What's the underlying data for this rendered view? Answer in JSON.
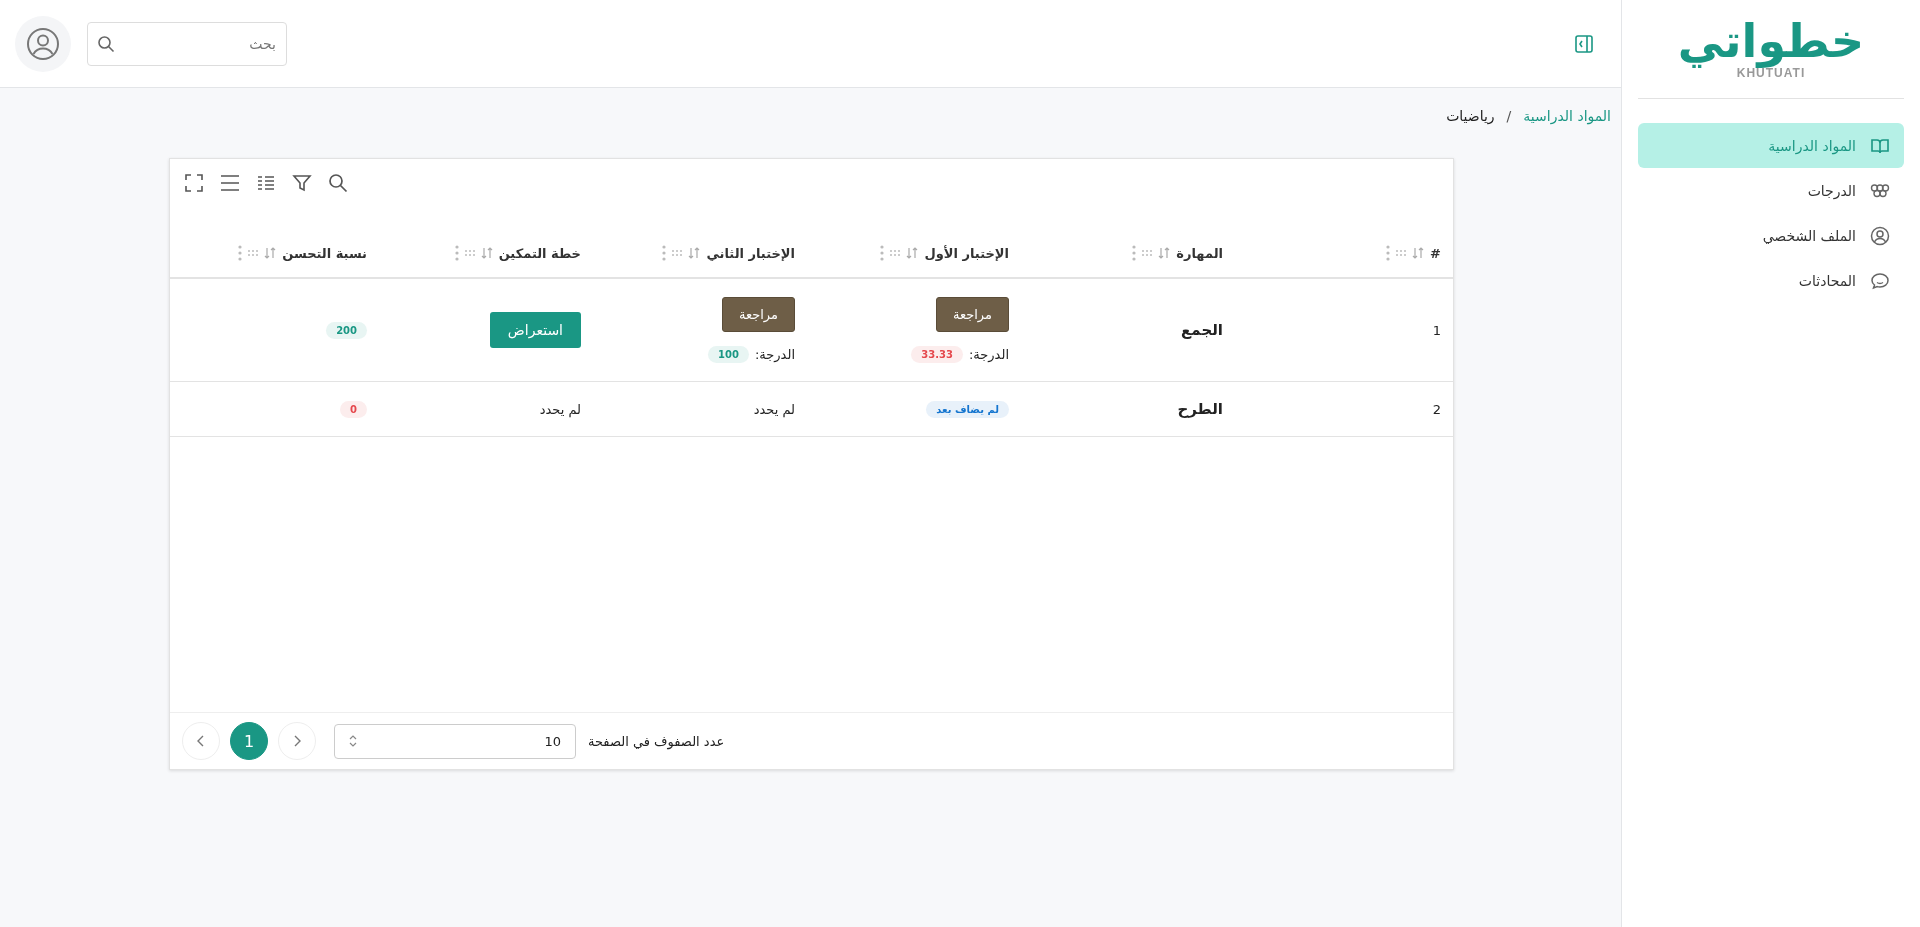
{
  "logo": {
    "mark": "خطواتي",
    "wordmark": "KHUTUATI"
  },
  "sidebar": {
    "items": [
      {
        "label": "المواد الدراسية",
        "selected": true
      },
      {
        "label": "الدرجات",
        "selected": false
      },
      {
        "label": "الملف الشخصي",
        "selected": false
      },
      {
        "label": "المحادثات",
        "selected": false
      }
    ]
  },
  "header": {
    "search": {
      "placeholder": "بحث"
    }
  },
  "breadcrumb": {
    "separator": "/",
    "items": [
      {
        "label": "المواد الدراسية",
        "kind": "link"
      },
      {
        "label": "رياضيات",
        "kind": "current"
      }
    ]
  },
  "table": {
    "columns": [
      "#",
      "المهارة",
      "الإختبار الأول",
      "الإختبار الثاني",
      "خطة التمكين",
      "نسبة التحسن"
    ],
    "rows": [
      {
        "number": "1",
        "skill": "الجمع",
        "test_1": {
          "kind": "review",
          "button": "مراجعة",
          "grade_label": "الدرجة:",
          "grade": "33.33",
          "color": "#e5484d"
        },
        "test_2": {
          "kind": "review",
          "button": "مراجعة",
          "grade_label": "الدرجة:",
          "grade": "100",
          "color": "#1a9784"
        },
        "plan": {
          "kind": "button",
          "text": "استعراض"
        },
        "improvement": {
          "text": "200",
          "color": "#1a9784"
        }
      },
      {
        "number": "2",
        "skill": "الطرح",
        "test_1": {
          "kind": "badge",
          "text": "لم يضاف بعد",
          "color": "#1475cf"
        },
        "test_2": {
          "kind": "text",
          "text": "لم يحدد"
        },
        "plan": {
          "kind": "text",
          "text": "لم يحدد"
        },
        "improvement": {
          "text": "0",
          "color": "#e5484d"
        }
      }
    ],
    "footer": {
      "rows_per_page_label": "عدد الصفوف في الصفحة",
      "rows_per_page": "10",
      "pages": [
        {
          "label": "1",
          "selected": true
        }
      ]
    }
  }
}
